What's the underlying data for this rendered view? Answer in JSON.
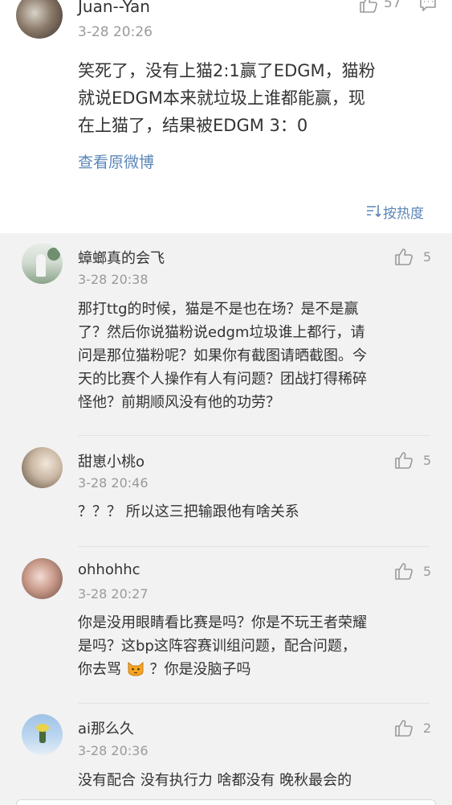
{
  "main_post": {
    "author": "Juan--Yan",
    "time": "3-28 20:26",
    "like_count": "57",
    "text_lines": [
      "笑死了，没有上猫2:1赢了EDGM，猫粉",
      "就说EDGM本来就垃圾上谁都能赢，现",
      "在上猫了，结果被EDGM 3：0"
    ],
    "view_original": "查看原微博"
  },
  "sort": {
    "label": "按热度",
    "icon": "sort-icon"
  },
  "comments": [
    {
      "author": "蟑螂真的会飞",
      "time": "3-28 20:38",
      "likes": "5",
      "lines": [
        "那打ttg的时候，猫是不是也在场？是不是赢",
        "了？然后你说猫粉说edgm垃圾谁上都行，请",
        "问是那位猫粉呢？如果你有截图请晒截图。今",
        "天的比赛个人操作有人有问题？团战打得稀碎",
        "怪他？前期顺风没有他的功劳？"
      ]
    },
    {
      "author": "甜崽小桃o",
      "time": "3-28 20:46",
      "likes": "5",
      "lines": [
        "？？？ 所以这三把输跟他有啥关系"
      ]
    },
    {
      "author": "ohhohhc",
      "time": "3-28 20:27",
      "likes": "5",
      "lines": [
        "你是没用眼睛看比赛是吗？你是不玩王者荣耀",
        "是吗？这bp这阵容赛训组问题，配合问题，",
        "你去骂",
        " ？你是没脑子吗"
      ]
    },
    {
      "author": "ai那么久",
      "time": "3-28 20:36",
      "likes": "2",
      "lines": [
        "没有配合 没有执行力 啥都没有  晚秋最会的"
      ]
    }
  ],
  "colors": {
    "link": "#5b86b8",
    "meta": "#9a9a9a",
    "text": "#333333"
  }
}
